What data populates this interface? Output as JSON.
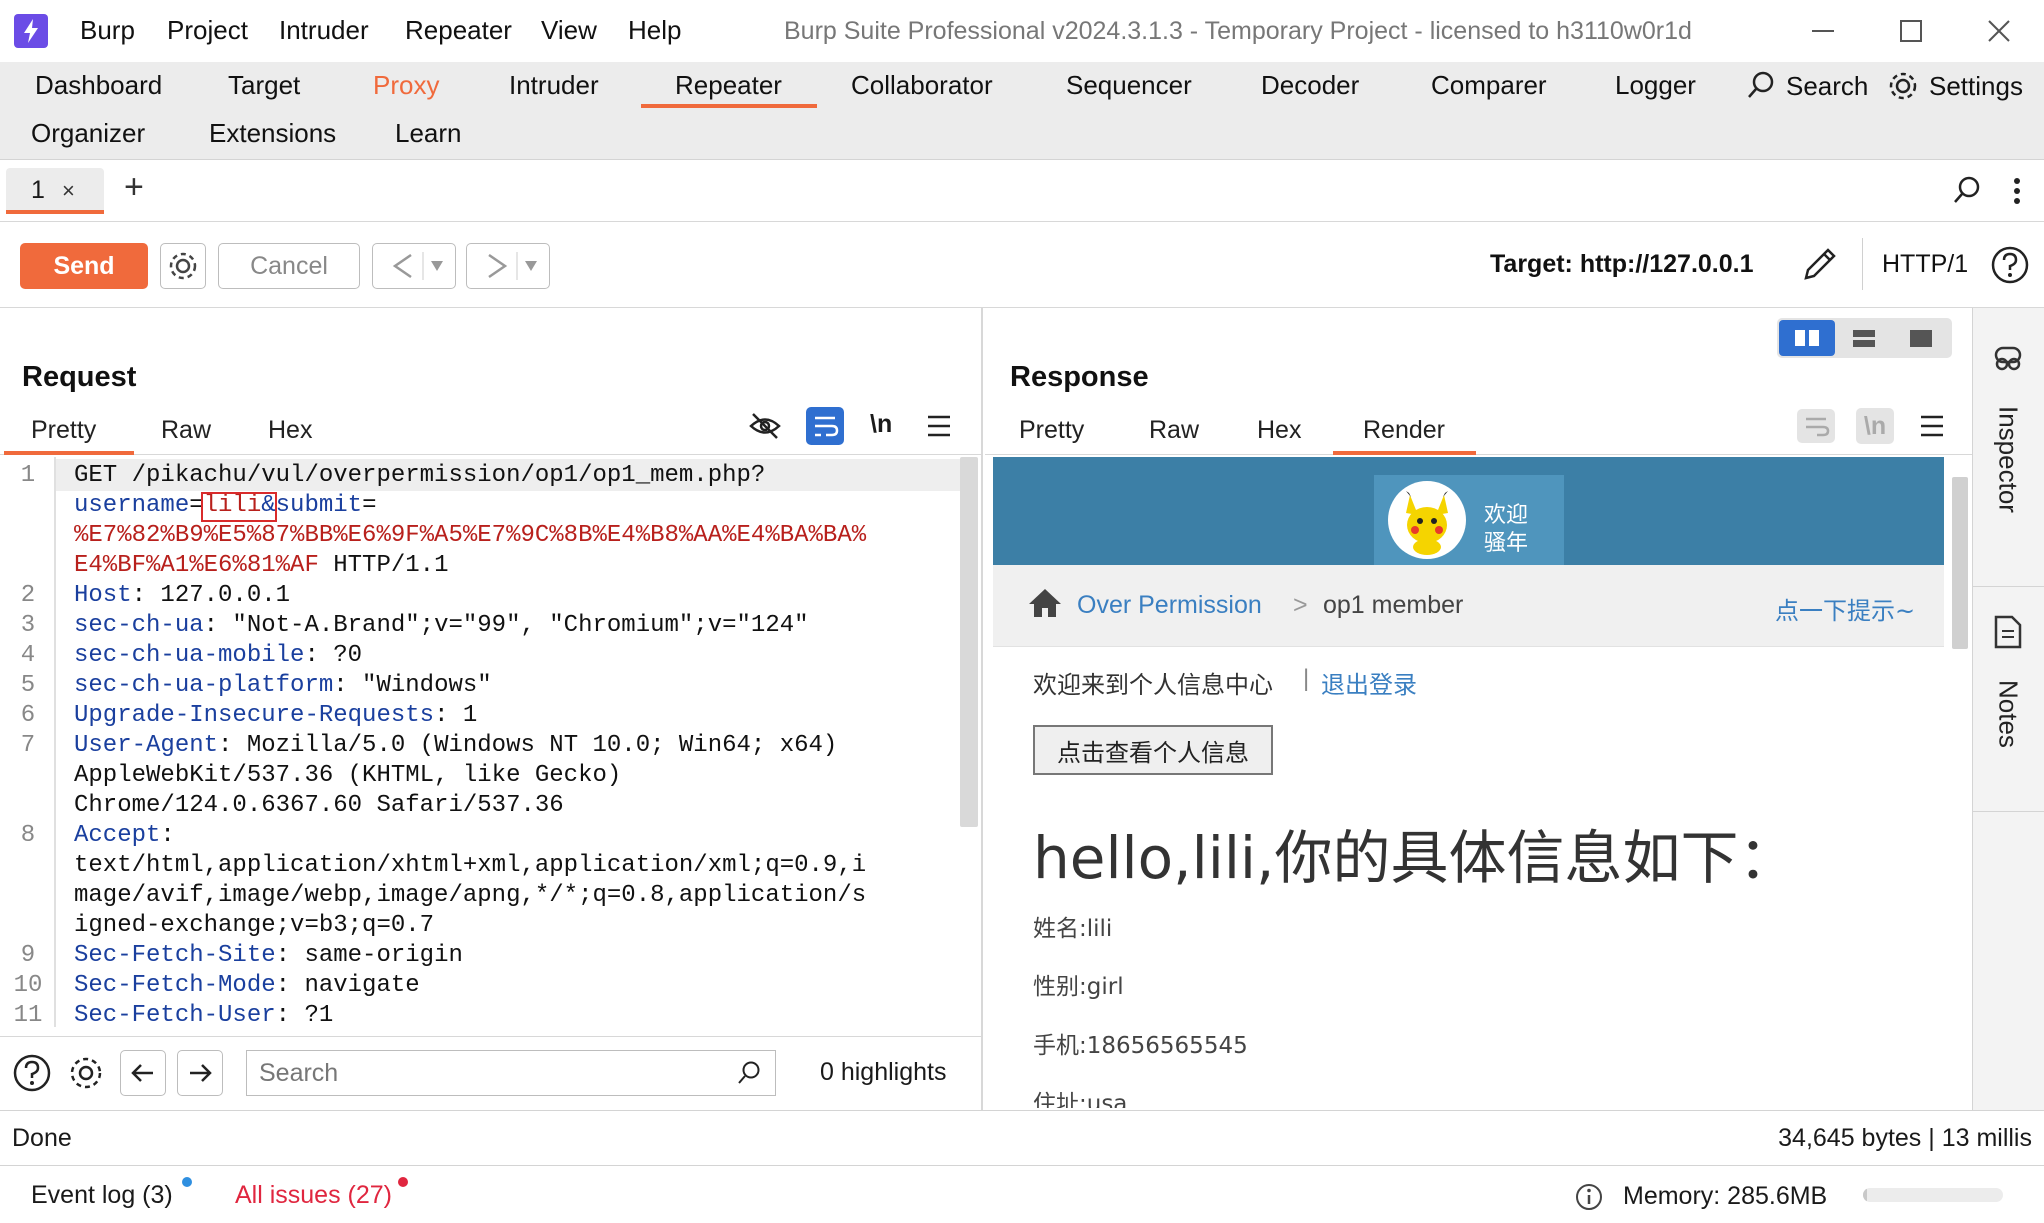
{
  "window": {
    "title": "Burp Suite Professional v2024.3.1.3 - Temporary Project - licensed to h3110w0r1d",
    "menu": [
      "Burp",
      "Project",
      "Intruder",
      "Repeater",
      "View",
      "Help"
    ]
  },
  "main_tabs": {
    "row1": [
      "Dashboard",
      "Target",
      "Proxy",
      "Intruder",
      "Repeater",
      "Collaborator",
      "Sequencer",
      "Decoder",
      "Comparer",
      "Logger"
    ],
    "row2": [
      "Organizer",
      "Extensions",
      "Learn"
    ],
    "search_label": "Search",
    "settings_label": "Settings",
    "active": "Repeater"
  },
  "repeater_tab": {
    "label": "1",
    "close": "×",
    "add": "+"
  },
  "toolbar": {
    "send_label": "Send",
    "cancel_label": "Cancel",
    "target_label": "Target: http://127.0.0.1",
    "http_version": "HTTP/1"
  },
  "request": {
    "title": "Request",
    "tabs": [
      "Pretty",
      "Raw",
      "Hex"
    ],
    "wrap_label": "\\n",
    "lines": [
      {
        "n": "1",
        "parts": [
          [
            "val",
            "GET /pikachu/vul/overpermission/op1/op1_mem.php?"
          ]
        ]
      },
      {
        "n": "",
        "parts": [
          [
            "key",
            "username"
          ],
          [
            "val",
            "="
          ],
          [
            "red",
            "lili"
          ],
          [
            "key",
            "&submit"
          ],
          [
            "val",
            "="
          ]
        ]
      },
      {
        "n": "",
        "parts": [
          [
            "red",
            "%E7%82%B9%E5%87%BB%E6%9F%A5%E7%9C%8B%E4%B8%AA%E4%BA%BA%"
          ]
        ]
      },
      {
        "n": "",
        "parts": [
          [
            "red",
            "E4%BF%A1%E6%81%AF"
          ],
          [
            "val",
            " HTTP/1.1"
          ]
        ]
      },
      {
        "n": "2",
        "parts": [
          [
            "key",
            "Host"
          ],
          [
            "val",
            ": 127.0.0.1"
          ]
        ]
      },
      {
        "n": "3",
        "parts": [
          [
            "key",
            "sec-ch-ua"
          ],
          [
            "val",
            ": \"Not-A.Brand\";v=\"99\", \"Chromium\";v=\"124\""
          ]
        ]
      },
      {
        "n": "4",
        "parts": [
          [
            "key",
            "sec-ch-ua-mobile"
          ],
          [
            "val",
            ": ?0"
          ]
        ]
      },
      {
        "n": "5",
        "parts": [
          [
            "key",
            "sec-ch-ua-platform"
          ],
          [
            "val",
            ": \"Windows\""
          ]
        ]
      },
      {
        "n": "6",
        "parts": [
          [
            "key",
            "Upgrade-Insecure-Requests"
          ],
          [
            "val",
            ": 1"
          ]
        ]
      },
      {
        "n": "7",
        "parts": [
          [
            "key",
            "User-Agent"
          ],
          [
            "val",
            ": Mozilla/5.0 (Windows NT 10.0; Win64; x64)"
          ]
        ]
      },
      {
        "n": "",
        "parts": [
          [
            "val",
            "AppleWebKit/537.36 (KHTML, like Gecko)"
          ]
        ]
      },
      {
        "n": "",
        "parts": [
          [
            "val",
            "Chrome/124.0.6367.60 Safari/537.36"
          ]
        ]
      },
      {
        "n": "8",
        "parts": [
          [
            "key",
            "Accept"
          ],
          [
            "val",
            ":"
          ]
        ]
      },
      {
        "n": "",
        "parts": [
          [
            "val",
            "text/html,application/xhtml+xml,application/xml;q=0.9,i"
          ]
        ]
      },
      {
        "n": "",
        "parts": [
          [
            "val",
            "mage/avif,image/webp,image/apng,*/*;q=0.8,application/s"
          ]
        ]
      },
      {
        "n": "",
        "parts": [
          [
            "val",
            "igned-exchange;v=b3;q=0.7"
          ]
        ]
      },
      {
        "n": "9",
        "parts": [
          [
            "key",
            "Sec-Fetch-Site"
          ],
          [
            "val",
            ": same-origin"
          ]
        ]
      },
      {
        "n": "10",
        "parts": [
          [
            "key",
            "Sec-Fetch-Mode"
          ],
          [
            "val",
            ": navigate"
          ]
        ]
      },
      {
        "n": "11",
        "parts": [
          [
            "key",
            "Sec-Fetch-User"
          ],
          [
            "val",
            ": ?1"
          ]
        ]
      }
    ],
    "search_placeholder": "Search",
    "highlights": "0 highlights"
  },
  "response": {
    "title": "Response",
    "tabs": [
      "Pretty",
      "Raw",
      "Hex",
      "Render"
    ],
    "wrap_label": "\\n",
    "render": {
      "badge_line1": "欢迎",
      "badge_line2": "骚年",
      "breadcrumb_link": "Over Permission",
      "breadcrumb_sep": ">",
      "breadcrumb_current": "op1 member",
      "hint_link": "点一下提示~",
      "welcome_text": "欢迎来到个人信息中心",
      "welcome_sep": "|",
      "logout_link": "退出登录",
      "view_button": "点击查看个人信息",
      "heading": "hello,lili,你的具体信息如下：",
      "fields": [
        "姓名:lili",
        "性别:girl",
        "手机:18656565545",
        "住址:usa"
      ]
    }
  },
  "side_panel": {
    "inspector": "Inspector",
    "notes": "Notes"
  },
  "status": {
    "left": "Done",
    "right": "34,645 bytes | 13 millis"
  },
  "bottom": {
    "event_log": "Event log (3)",
    "all_issues": "All issues (27)",
    "memory": "Memory: 285.6MB",
    "memory_fraction": 0.03
  },
  "colors": {
    "accent": "#f06a3c",
    "logo": "#6b4ce6",
    "header_blue": "#3c7fa6",
    "link_blue": "#3a7fc1"
  }
}
